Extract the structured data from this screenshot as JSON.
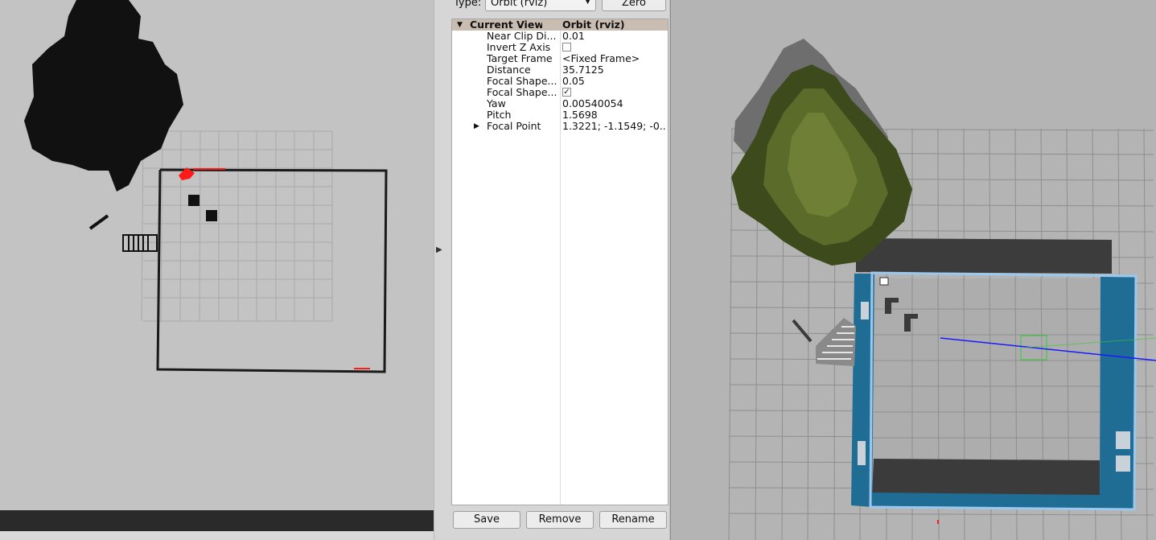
{
  "views_panel": {
    "type_label": "Type:",
    "type_value": "Orbit (rviz)",
    "zero_label": "Zero",
    "current_view": {
      "name": "Current View",
      "value": "Orbit (rviz)"
    },
    "properties": [
      {
        "name": "Near Clip Di...",
        "value": "0.01",
        "kind": "text"
      },
      {
        "name": "Invert Z Axis",
        "value": "",
        "kind": "checkbox",
        "checked": false
      },
      {
        "name": "Target Frame",
        "value": "<Fixed Frame>",
        "kind": "text"
      },
      {
        "name": "Distance",
        "value": "35.7125",
        "kind": "text"
      },
      {
        "name": "Focal Shape...",
        "value": "0.05",
        "kind": "text"
      },
      {
        "name": "Focal Shape...",
        "value": "",
        "kind": "checkbox",
        "checked": true
      },
      {
        "name": "Yaw",
        "value": "0.00540054",
        "kind": "text"
      },
      {
        "name": "Pitch",
        "value": "1.5698",
        "kind": "text"
      },
      {
        "name": "Focal Point",
        "value": "1.3221; -1.1549; -0...",
        "kind": "text",
        "expandable": true
      }
    ],
    "buttons": {
      "save": "Save",
      "remove": "Remove",
      "rename": "Rename"
    },
    "check_mark": "✓"
  },
  "colors": {
    "map_background": "#c3c3c3",
    "occupied": "#111111",
    "laser_scan": "#ff1a1a",
    "header_row": "#c9bdb2",
    "wall_blue": "#1f6c95",
    "selection_outline": "#9cc8ee",
    "tree_green": "#4b5a23"
  },
  "icons": {
    "expand_collapsed": "▶",
    "expand_open": "▼",
    "dropdown": "▼"
  }
}
